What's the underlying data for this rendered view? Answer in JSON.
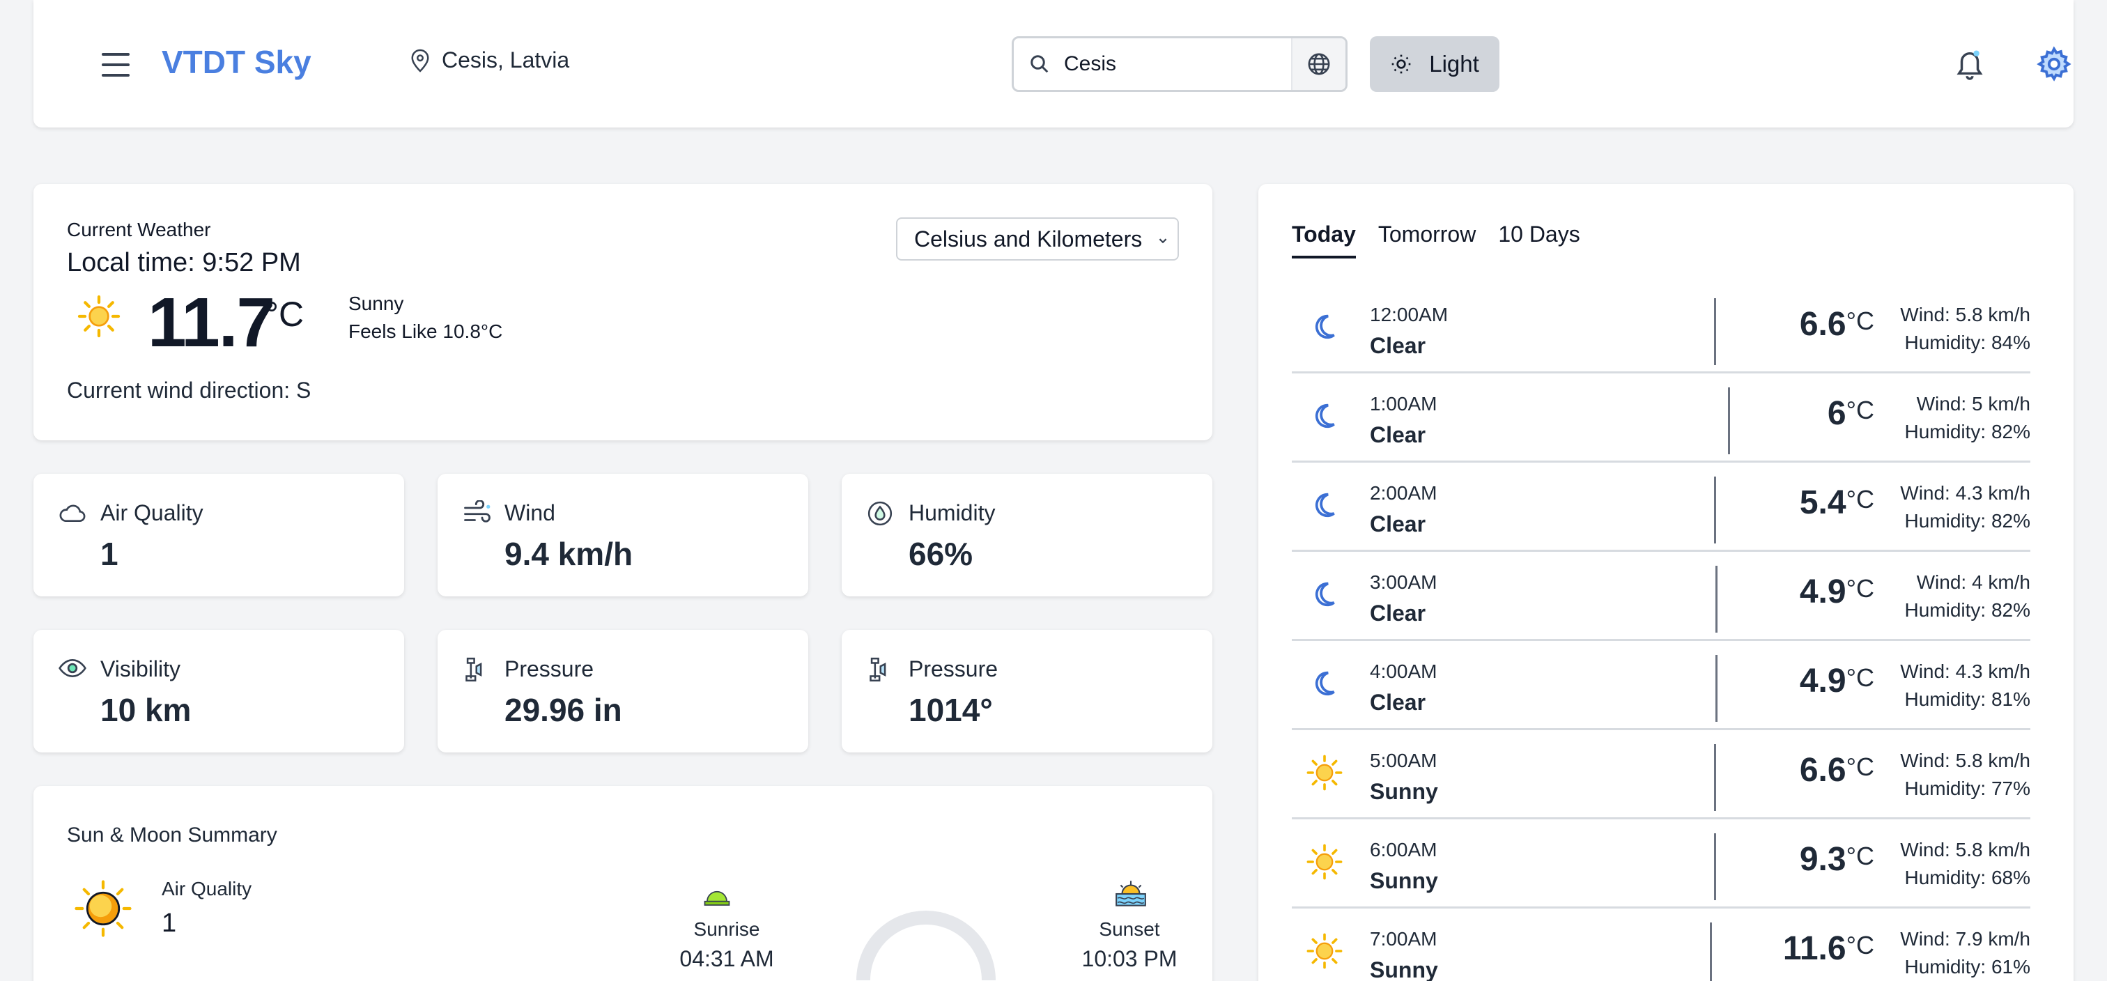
{
  "header": {
    "brand": "VTDT Sky",
    "location": "Cesis, Latvia",
    "search_value": "Cesis",
    "theme_label": "Light"
  },
  "current": {
    "label": "Current Weather",
    "local_time": "Local time: 9:52 PM",
    "temp": "11.7",
    "unit": "°C",
    "condition": "Sunny",
    "feels_like": "Feels Like 10.8°C",
    "wind_direction": "Current wind direction: S",
    "unit_select": "Celsius and Kilometers"
  },
  "stats": [
    {
      "label": "Air Quality",
      "value": "1",
      "icon": "cloud-icon"
    },
    {
      "label": "Wind",
      "value": "9.4 km/h",
      "icon": "wind-icon"
    },
    {
      "label": "Humidity",
      "value": "66%",
      "icon": "droplet-icon"
    },
    {
      "label": "Visibility",
      "value": "10 km",
      "icon": "eye-icon"
    },
    {
      "label": "Pressure",
      "value": "29.96 in",
      "icon": "barometer-icon"
    },
    {
      "label": "Pressure",
      "value": "1014°",
      "icon": "barometer-icon"
    }
  ],
  "sunmoon": {
    "title": "Sun & Moon Summary",
    "aq_label": "Air Quality",
    "aq_value": "1",
    "sunrise_label": "Sunrise",
    "sunrise_time": "04:31 AM",
    "sunset_label": "Sunset",
    "sunset_time": "10:03 PM"
  },
  "forecast": {
    "tabs": [
      "Today",
      "Tomorrow",
      "10 Days"
    ],
    "active_tab": 0,
    "hours": [
      {
        "time": "12:00AM",
        "cond": "Clear",
        "temp": "6.6",
        "wind": "Wind: 5.8 km/h",
        "humidity": "Humidity: 84%",
        "icon": "moon"
      },
      {
        "time": "1:00AM",
        "cond": "Clear",
        "temp": "6",
        "wind": "Wind: 5 km/h",
        "humidity": "Humidity: 82%",
        "icon": "moon"
      },
      {
        "time": "2:00AM",
        "cond": "Clear",
        "temp": "5.4",
        "wind": "Wind: 4.3 km/h",
        "humidity": "Humidity: 82%",
        "icon": "moon"
      },
      {
        "time": "3:00AM",
        "cond": "Clear",
        "temp": "4.9",
        "wind": "Wind: 4 km/h",
        "humidity": "Humidity: 82%",
        "icon": "moon"
      },
      {
        "time": "4:00AM",
        "cond": "Clear",
        "temp": "4.9",
        "wind": "Wind: 4.3 km/h",
        "humidity": "Humidity: 81%",
        "icon": "moon"
      },
      {
        "time": "5:00AM",
        "cond": "Sunny",
        "temp": "6.6",
        "wind": "Wind: 5.8 km/h",
        "humidity": "Humidity: 77%",
        "icon": "sun"
      },
      {
        "time": "6:00AM",
        "cond": "Sunny",
        "temp": "9.3",
        "wind": "Wind: 5.8 km/h",
        "humidity": "Humidity: 68%",
        "icon": "sun"
      },
      {
        "time": "7:00AM",
        "cond": "Sunny",
        "temp": "11.6",
        "wind": "Wind: 7.9 km/h",
        "humidity": "Humidity: 61%",
        "icon": "sun"
      }
    ],
    "unit": "°C"
  },
  "colors": {
    "brand": "#4a7fe0",
    "moon": "#3b6fd4",
    "sun": "#f5b800"
  }
}
